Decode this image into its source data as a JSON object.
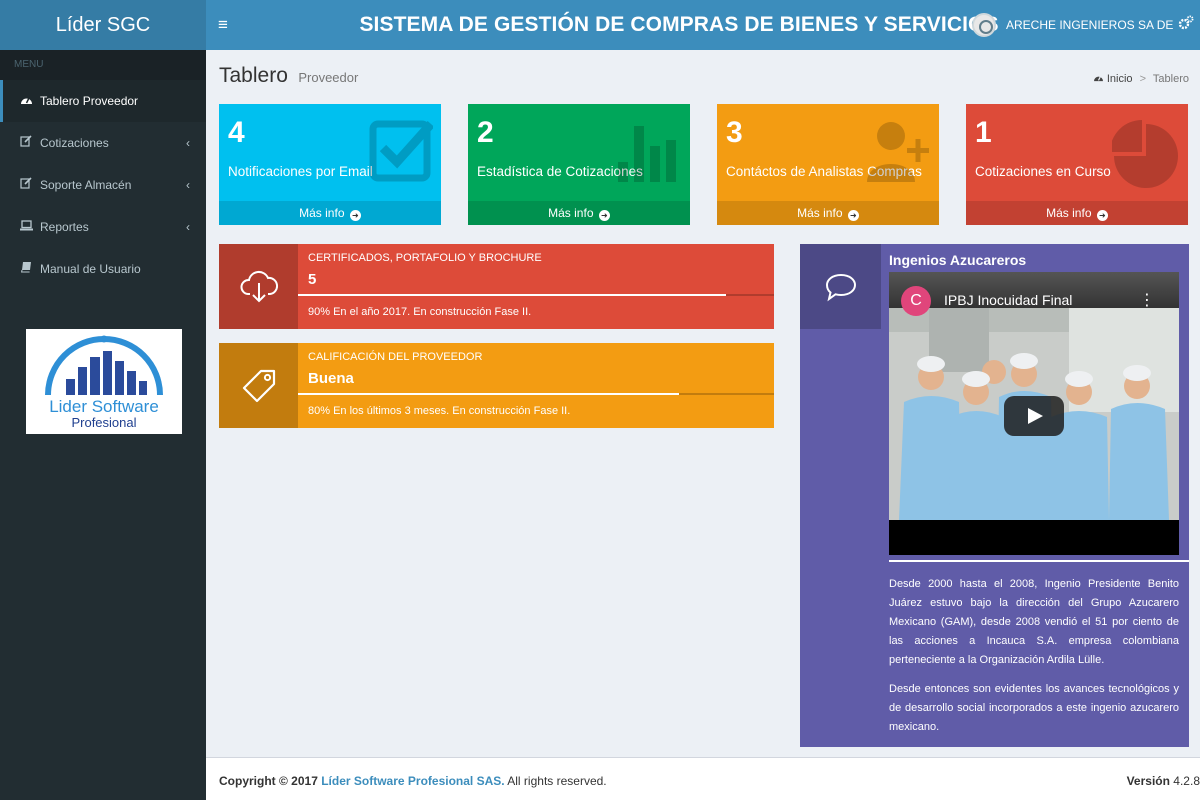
{
  "brand": "Líder SGC",
  "header": {
    "toggle": "≡",
    "title": "SISTEMA DE GESTIÓN DE COMPRAS DE BIENES Y SERVICIOS",
    "user": "ARECHE INGENIEROS SA DE",
    "settings_icon": "gears-icon"
  },
  "sidebar": {
    "header": "MENU",
    "items": [
      {
        "label": "Tablero Proveedor",
        "icon": "dashboard-icon",
        "active": true
      },
      {
        "label": "Cotizaciones",
        "icon": "edit-icon",
        "arrow": "‹"
      },
      {
        "label": "Soporte Almacén",
        "icon": "edit-icon",
        "arrow": "‹"
      },
      {
        "label": "Reportes",
        "icon": "laptop-icon",
        "arrow": "‹"
      },
      {
        "label": "Manual de Usuario",
        "icon": "book-icon"
      }
    ],
    "logo": {
      "line1": "Lider Software",
      "line2": "Profesional"
    }
  },
  "content": {
    "title": "Tablero",
    "subtitle": "Proveedor",
    "breadcrumb": {
      "home": "Inicio",
      "current": "Tablero"
    }
  },
  "small_boxes": [
    {
      "number": "4",
      "label": "Notificaciones por Email",
      "footer": "Más info",
      "color": "#00c0ef",
      "icon": "check-square-icon"
    },
    {
      "number": "2",
      "label": "Estadística de Cotizaciones",
      "footer": "Más info",
      "color": "#00a65a",
      "icon": "bar-chart-icon"
    },
    {
      "number": "3",
      "label": "Contáctos de Analistas Compras",
      "footer": "Más info",
      "color": "#f39c12",
      "icon": "user-plus-icon"
    },
    {
      "number": "1",
      "label": "Cotizaciones en Curso",
      "footer": "Más info",
      "color": "#dd4b39",
      "icon": "pie-chart-icon"
    }
  ],
  "info_boxes": [
    {
      "title": "CERTIFICADOS, PORTAFOLIO Y BROCHURE",
      "value": "5",
      "progress": 0.9,
      "description": "90% En el año 2017. En construcción Fase II.",
      "color": "#dd4b39",
      "icon": "cloud-download-icon"
    },
    {
      "title": "CALIFICACIÓN DEL PROVEEDOR",
      "value": "Buena",
      "progress": 0.8,
      "description": "80% En los últimos 3 meses. En construcción Fase II.",
      "color": "#f39c12",
      "icon": "tag-icon"
    }
  ],
  "video_box": {
    "title": "Ingenios Azucareros",
    "video_channel_initial": "C",
    "video_title": "IPBJ Inocuidad Final",
    "video_menu": "⋮",
    "paragraph1": "Desde 2000 hasta el 2008, Ingenio Presidente Benito Juárez estuvo bajo la dirección del Grupo Azucarero Mexicano (GAM), desde 2008 vendió el 51 por ciento de las acciones a Incauca S.A. empresa colombiana perteneciente a la Organización Ardila Lülle.",
    "paragraph2": "Desde entonces son evidentes los avances tecnológicos y de desarrollo social incorporados a este ingenio azucarero mexicano.",
    "color": "#605ca8",
    "icon": "comment-icon"
  },
  "footer": {
    "copyright_prefix": "Copyright © 2017",
    "company": "Líder Software Profesional SAS.",
    "rights": "All rights reserved.",
    "version_label": "Versión",
    "version": "4.2.8"
  }
}
